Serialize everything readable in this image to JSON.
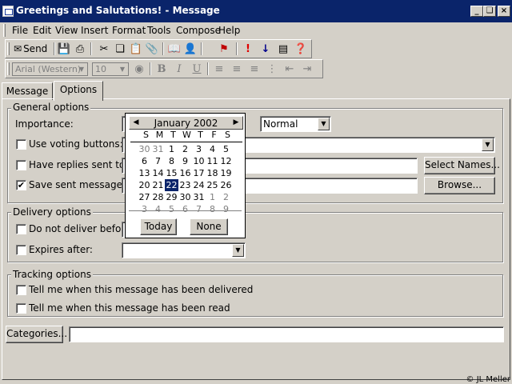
{
  "window": {
    "title": "Greetings and Salutations! - Message",
    "controls": [
      "_",
      "❏",
      "×"
    ]
  },
  "menu": {
    "items": [
      {
        "label": "File"
      },
      {
        "label": "Edit"
      },
      {
        "label": "View"
      },
      {
        "label": "Insert"
      },
      {
        "label": "Format"
      },
      {
        "label": "Tools"
      },
      {
        "label": "Compose"
      },
      {
        "label": "Help"
      }
    ]
  },
  "toolbar": {
    "send_label": "Send",
    "font_name": "Arial (Western)",
    "font_size": "10"
  },
  "tabs": [
    {
      "label": "Message"
    },
    {
      "label": "Options"
    }
  ],
  "general": {
    "title": "General options",
    "importance_label": "Importance:",
    "importance_value": "Normal",
    "voting_label": "Use voting buttons:",
    "replies_label": "Have replies sent to:",
    "save_label": "Save sent message to:",
    "save_checked": "✔",
    "select_names_button": "Select Names...",
    "browse_button": "Browse..."
  },
  "delivery": {
    "title": "Delivery options",
    "not_before_label": "Do not deliver before:",
    "expires_label": "Expires after:"
  },
  "tracking": {
    "title": "Tracking options",
    "delivered_label": "Tell me when this message has been delivered",
    "read_label": "Tell me when this message has been read"
  },
  "categories_button": "Categories...",
  "calendar": {
    "month": "January 2002",
    "weekdays": [
      "S",
      "M",
      "T",
      "W",
      "T",
      "F",
      "S"
    ],
    "selected_day": "22",
    "weeks": [
      [
        "30",
        "31",
        "1",
        "2",
        "3",
        "4",
        "5"
      ],
      [
        "6",
        "7",
        "8",
        "9",
        "10",
        "11",
        "12"
      ],
      [
        "13",
        "14",
        "15",
        "16",
        "17",
        "18",
        "19"
      ],
      [
        "20",
        "21",
        "22",
        "23",
        "24",
        "25",
        "26"
      ],
      [
        "27",
        "28",
        "29",
        "30",
        "31",
        "1",
        "2"
      ],
      [
        "3",
        "4",
        "5",
        "6",
        "7",
        "8",
        "9"
      ]
    ],
    "today_button": "Today",
    "none_button": "None"
  },
  "copyright": "© JL Meller"
}
